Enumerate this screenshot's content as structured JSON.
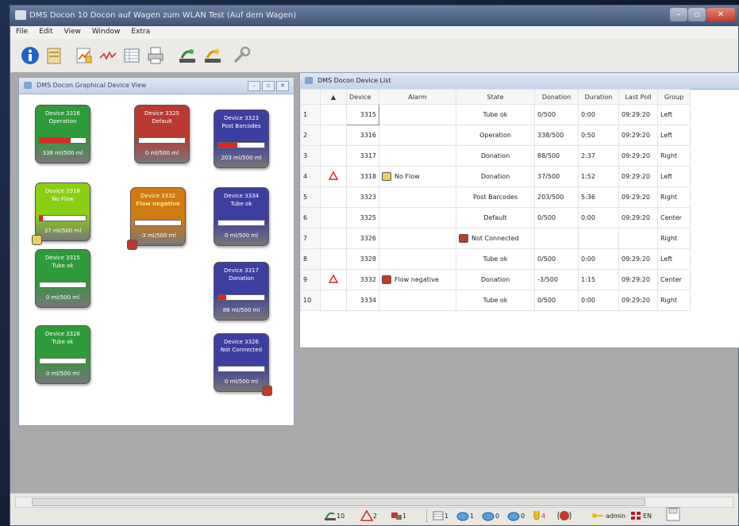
{
  "window": {
    "title": "DMS Docon 10 Docon auf Wagen zum WLAN Test (Auf dem Wagen)"
  },
  "menu": [
    "File",
    "Edit",
    "View",
    "Window",
    "Extra"
  ],
  "toolbar": {
    "icons": [
      "info-icon",
      "notes-icon",
      "report-icon",
      "curve-icon",
      "table-icon",
      "printer-icon",
      "scale-green-icon",
      "scale-yellow-icon",
      "wrench-icon"
    ]
  },
  "graphical_view": {
    "title": "DMS Docon Graphical Device View",
    "tiles": [
      {
        "name": "Device 3316",
        "state": "Operation",
        "volume": "338 ml/500 ml",
        "fill": 0.676,
        "color": "green"
      },
      {
        "name": "Device 3325",
        "state": "Default",
        "volume": "0 ml/500 ml",
        "fill": 0,
        "color": "red"
      },
      {
        "name": "Device 3323",
        "state": "Post Barcodes",
        "volume": "203 ml/500 ml",
        "fill": 0.406,
        "color": "blue"
      },
      {
        "name": "Device 3318",
        "state": "No Flow",
        "volume": "37 ml/500 ml",
        "fill": 0.074,
        "color": "lime",
        "note": "flow-icon"
      },
      {
        "name": "Device 3332",
        "state": "Flow negative",
        "volume": "-3 ml/500 ml",
        "fill": 0,
        "color": "orange",
        "note": "negative-flow-icon"
      },
      {
        "name": "Device 3334",
        "state": "Tube ok",
        "volume": "0 ml/500 ml",
        "fill": 0,
        "color": "blue"
      },
      {
        "name": "Device 3315",
        "state": "Tube ok",
        "volume": "0 ml/500 ml",
        "fill": 0,
        "color": "green"
      },
      {
        "name": "Device 3317",
        "state": "Donation",
        "volume": "88 ml/500 ml",
        "fill": 0.176,
        "color": "blue"
      },
      {
        "name": "Device 3328",
        "state": "Tube ok",
        "volume": "0 ml/500 ml",
        "fill": 0,
        "color": "green"
      },
      {
        "name": "Device 3326",
        "state": "Not Connected",
        "volume": "0 ml/500 ml",
        "fill": 0,
        "color": "blue",
        "note": "disconnected-icon"
      }
    ]
  },
  "device_list": {
    "title": "DMS Docon Device List",
    "columns": [
      "Device",
      "Alarm",
      "State",
      "Donation",
      "Duration",
      "Last Poll",
      "Group"
    ],
    "rows": [
      {
        "n": "1",
        "warn": "",
        "device": "3315",
        "alarm": "",
        "alarm_icon": "",
        "state": "Tube ok",
        "donation": "0/500",
        "duration": "0:00",
        "last_poll": "09:29:20",
        "group": "Left"
      },
      {
        "n": "2",
        "warn": "",
        "device": "3316",
        "alarm": "",
        "alarm_icon": "",
        "state": "Operation",
        "donation": "338/500",
        "duration": "0:50",
        "last_poll": "09:29:20",
        "group": "Left"
      },
      {
        "n": "3",
        "warn": "",
        "device": "3317",
        "alarm": "",
        "alarm_icon": "",
        "state": "Donation",
        "donation": "88/500",
        "duration": "2:37",
        "last_poll": "09:29:20",
        "group": "Right"
      },
      {
        "n": "4",
        "warn": "warning-icon",
        "device": "3318",
        "alarm": "No Flow",
        "alarm_icon": "no-flow-icon",
        "state": "Donation",
        "donation": "37/500",
        "duration": "1:52",
        "last_poll": "09:29:20",
        "group": "Left"
      },
      {
        "n": "5",
        "warn": "",
        "device": "3323",
        "alarm": "",
        "alarm_icon": "",
        "state": "Post Barcodes",
        "donation": "203/500",
        "duration": "5:36",
        "last_poll": "09:29:20",
        "group": "Right"
      },
      {
        "n": "6",
        "warn": "",
        "device": "3325",
        "alarm": "",
        "alarm_icon": "",
        "state": "Default",
        "donation": "0/500",
        "duration": "0:00",
        "last_poll": "09:29:20",
        "group": "Center"
      },
      {
        "n": "7",
        "warn": "",
        "device": "3326",
        "alarm": "",
        "alarm_icon": "",
        "state": "Not Connected",
        "state_icon": "disconnected-icon",
        "donation": "",
        "duration": "",
        "last_poll": "",
        "group": "Right"
      },
      {
        "n": "8",
        "warn": "",
        "device": "3328",
        "alarm": "",
        "alarm_icon": "",
        "state": "Tube ok",
        "donation": "0/500",
        "duration": "0:00",
        "last_poll": "09:29:20",
        "group": "Left"
      },
      {
        "n": "9",
        "warn": "warning-icon",
        "device": "3332",
        "alarm": "Flow negative",
        "alarm_icon": "flow-negative-icon",
        "state": "Donation",
        "donation": "-3/500",
        "duration": "1:15",
        "last_poll": "09:29:20",
        "group": "Center"
      },
      {
        "n": "10",
        "warn": "",
        "device": "3334",
        "alarm": "",
        "alarm_icon": "",
        "state": "Tube ok",
        "donation": "0/500",
        "duration": "0:00",
        "last_poll": "09:29:20",
        "group": "Right"
      }
    ]
  },
  "status": {
    "devices": "10",
    "warnings": "2",
    "disconnected": "1",
    "lists": "1",
    "tubes_a": "1",
    "tubes_b": "0",
    "tubes_c": "0",
    "flags": "4",
    "user": "admin",
    "lang": "EN"
  },
  "colors": {
    "green": "#2f9a3a",
    "red": "#b83a32",
    "blue": "#3c3fa0",
    "lime": "#8bcf12",
    "orange": "#d27a12"
  }
}
